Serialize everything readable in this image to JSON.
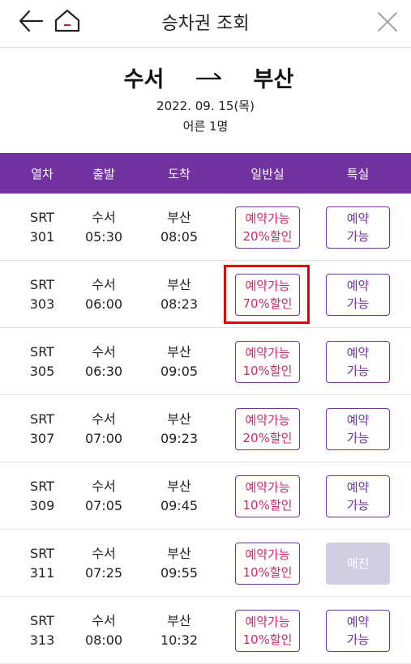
{
  "header": {
    "title": "승차권 조회"
  },
  "route": {
    "from": "수서",
    "to": "부산",
    "date": "2022. 09. 15(목)",
    "passengers": "어른 1명"
  },
  "table": {
    "headers": {
      "train": "열차",
      "depart": "출발",
      "arrive": "도착",
      "general": "일반실",
      "special": "특실"
    },
    "rows": [
      {
        "train": "SRT",
        "num": "301",
        "dep_station": "수서",
        "dep_time": "05:30",
        "arr_station": "부산",
        "arr_time": "08:05",
        "gen_status": "예약가능",
        "gen_discount": "20%할인",
        "spc_line1": "예약",
        "spc_line2": "가능",
        "spc_soldout": ""
      },
      {
        "train": "SRT",
        "num": "303",
        "dep_station": "수서",
        "dep_time": "06:00",
        "arr_station": "부산",
        "arr_time": "08:23",
        "gen_status": "예약가능",
        "gen_discount": "70%할인",
        "spc_line1": "예약",
        "spc_line2": "가능",
        "spc_soldout": ""
      },
      {
        "train": "SRT",
        "num": "305",
        "dep_station": "수서",
        "dep_time": "06:30",
        "arr_station": "부산",
        "arr_time": "09:05",
        "gen_status": "예약가능",
        "gen_discount": "10%할인",
        "spc_line1": "예약",
        "spc_line2": "가능",
        "spc_soldout": ""
      },
      {
        "train": "SRT",
        "num": "307",
        "dep_station": "수서",
        "dep_time": "07:00",
        "arr_station": "부산",
        "arr_time": "09:23",
        "gen_status": "예약가능",
        "gen_discount": "20%할인",
        "spc_line1": "예약",
        "spc_line2": "가능",
        "spc_soldout": ""
      },
      {
        "train": "SRT",
        "num": "309",
        "dep_station": "수서",
        "dep_time": "07:05",
        "arr_station": "부산",
        "arr_time": "09:45",
        "gen_status": "예약가능",
        "gen_discount": "10%할인",
        "spc_line1": "예약",
        "spc_line2": "가능",
        "spc_soldout": ""
      },
      {
        "train": "SRT",
        "num": "311",
        "dep_station": "수서",
        "dep_time": "07:25",
        "arr_station": "부산",
        "arr_time": "09:55",
        "gen_status": "예약가능",
        "gen_discount": "10%할인",
        "spc_line1": "",
        "spc_line2": "",
        "spc_soldout": "매진"
      },
      {
        "train": "SRT",
        "num": "313",
        "dep_station": "수서",
        "dep_time": "08:00",
        "arr_station": "부산",
        "arr_time": "10:32",
        "gen_status": "예약가능",
        "gen_discount": "10%할인",
        "spc_line1": "예약",
        "spc_line2": "가능",
        "spc_soldout": ""
      }
    ]
  },
  "colors": {
    "accent": "#7232a0",
    "discount": "#cc2a6a",
    "soldout_bg": "#d3cde3",
    "highlight": "#e00000"
  },
  "icons": {
    "back": "back-arrow-icon",
    "home": "home-icon",
    "close": "close-icon",
    "route": "route-arrow-icon"
  }
}
